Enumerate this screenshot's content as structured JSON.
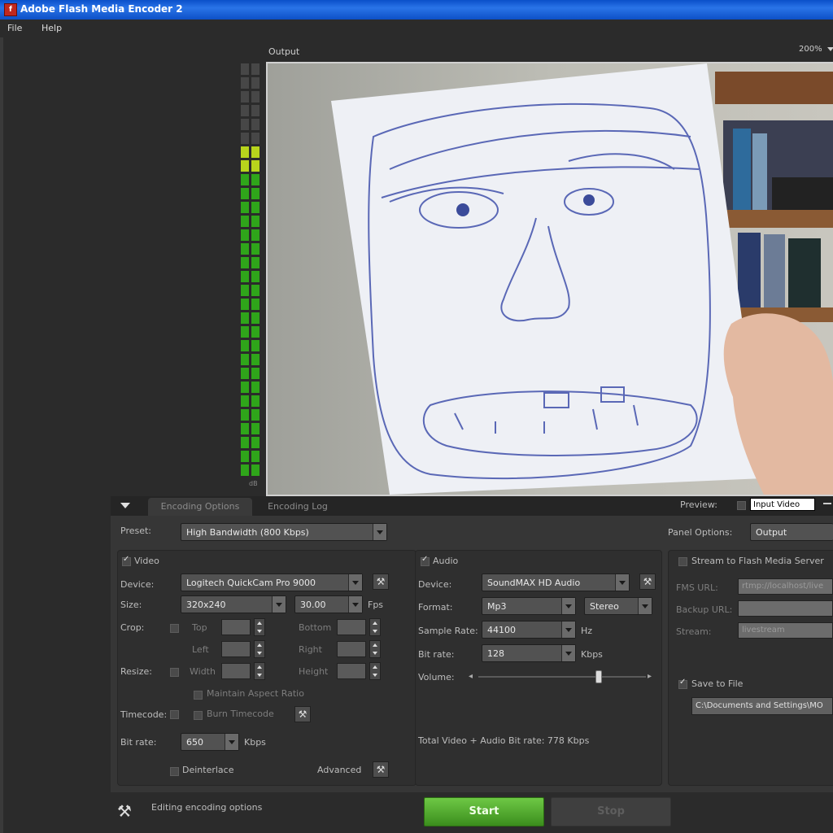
{
  "window": {
    "title": "Adobe Flash Media Encoder 2",
    "icon": "flash-media-encoder-icon"
  },
  "menu": [
    "File",
    "Help"
  ],
  "output": {
    "label": "Output",
    "zoom": "200%"
  },
  "vu_meter": {
    "left_lit": 24,
    "right_lit": 24,
    "yellow_segments": 2,
    "segments_total": 30,
    "label": "dB"
  },
  "preview": {
    "label": "Preview:",
    "value": "Input Video"
  },
  "tabs": [
    "Encoding Options",
    "Encoding Log"
  ],
  "preset": {
    "label": "Preset:",
    "value": "High Bandwidth (800 Kbps)"
  },
  "panel_options": {
    "label": "Panel Options:",
    "value": "Output"
  },
  "video": {
    "label": "Video",
    "device_label": "Device:",
    "device": "Logitech QuickCam Pro 9000",
    "size_label": "Size:",
    "size": "320x240",
    "fps": "30.00",
    "fps_label": "Fps",
    "crop_label": "Crop:",
    "top_label": "Top",
    "bottom_label": "Bottom",
    "left_label": "Left",
    "right_label": "Right",
    "resize_label": "Resize:",
    "width_label": "Width",
    "height_label": "Height",
    "maintain_label": "Maintain Aspect Ratio",
    "timecode_label": "Timecode:",
    "burn_label": "Burn Timecode",
    "bitrate_label": "Bit rate:",
    "bitrate": "650",
    "bitrate_unit": "Kbps",
    "deinterlace_label": "Deinterlace",
    "advanced_label": "Advanced"
  },
  "audio": {
    "label": "Audio",
    "device_label": "Device:",
    "device": "SoundMAX HD Audio",
    "format_label": "Format:",
    "format": "Mp3",
    "channels": "Stereo",
    "sample_rate_label": "Sample Rate:",
    "sample_rate": "44100",
    "hz": "Hz",
    "bitrate_label": "Bit rate:",
    "bitrate": "128",
    "bitrate_unit": "Kbps",
    "volume_label": "Volume:",
    "volume": 0.72,
    "total_text": "Total Video + Audio Bit rate: 778 Kbps"
  },
  "stream": {
    "label": "Stream to Flash Media Server",
    "fms_label": "FMS URL:",
    "fms_value": "rtmp://localhost/live",
    "backup_label": "Backup URL:",
    "stream_label": "Stream:",
    "stream_value": "livestream",
    "save_label": "Save to File",
    "save_path": "C:\\Documents and Settings\\MO"
  },
  "status": {
    "text": "Editing encoding options"
  },
  "buttons": {
    "start": "Start",
    "stop": "Stop"
  }
}
